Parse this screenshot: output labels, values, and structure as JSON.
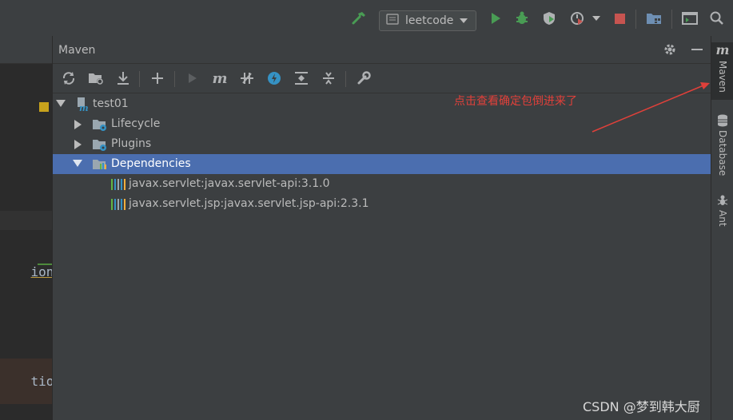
{
  "toolbar": {
    "run_config": "leetcode",
    "icons": [
      "hammer-build-icon",
      "run-config-icon",
      "run-icon",
      "debug-icon",
      "coverage-icon",
      "profile-icon",
      "dropdown-icon",
      "stop-icon",
      "project-structure-icon",
      "terminal-icon",
      "search-icon"
    ]
  },
  "editor": {
    "code_line_1": "ion, IC",
    "code_line_2": "tion, I"
  },
  "maven": {
    "title": "Maven",
    "toolbar_icons": [
      "reload-icon",
      "generate-sources-icon",
      "download-icon",
      "add-icon",
      "run-icon",
      "execute-goal-icon",
      "toggle-offline-icon",
      "skip-tests-icon",
      "show-dependencies-icon",
      "collapse-all-icon",
      "settings-wrench-icon"
    ],
    "tree": {
      "project": "test01",
      "lifecycle": "Lifecycle",
      "plugins": "Plugins",
      "dependencies": "Dependencies",
      "deps": [
        "javax.servlet:javax.servlet-api:3.1.0",
        "javax.servlet.jsp:javax.servlet.jsp-api:2.3.1"
      ]
    },
    "annotation": "点击查看确定包倒进来了"
  },
  "right_strip": {
    "maven_label": "Maven",
    "database_label": "Database",
    "ant_label": "Ant"
  },
  "watermark": "CSDN @梦到韩大厨",
  "colors": {
    "selection": "#4b6eaf",
    "annotation": "#e0403a",
    "run_green": "#499c54",
    "stop_red": "#c75450"
  }
}
